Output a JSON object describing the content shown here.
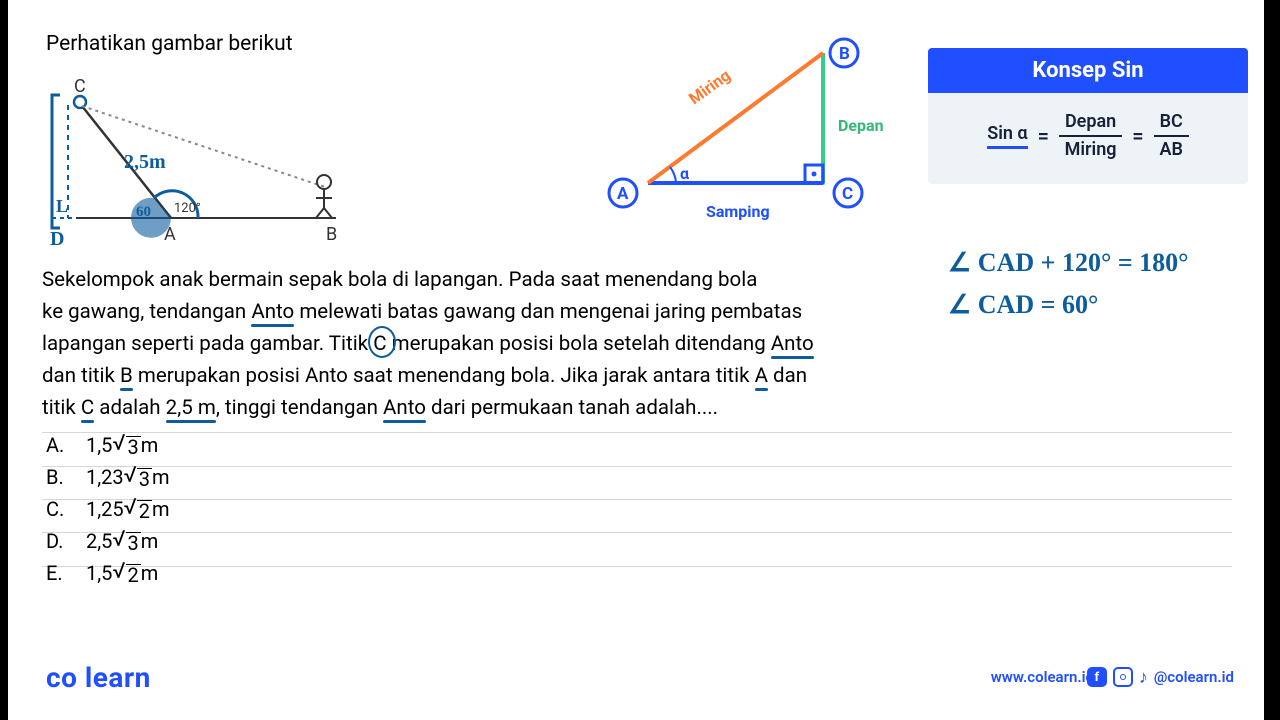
{
  "title": "Perhatikan gambar berikut",
  "concept": {
    "header": "Konsep Sin",
    "lhs": "Sin α",
    "frac1_num": "Depan",
    "frac1_den": "Miring",
    "frac2_num": "BC",
    "frac2_den": "AB"
  },
  "diagram": {
    "problem": {
      "len": "2,5m",
      "angle": "120°",
      "pA": "A",
      "pB": "B",
      "pC": "C",
      "pD": "D",
      "pL": "L",
      "ang60": "60"
    },
    "concept_tri": {
      "pA": "A",
      "pB": "B",
      "pC": "C",
      "alpha": "α",
      "side_hyp": "Miring",
      "side_opp": "Depan",
      "side_adj": "Samping"
    }
  },
  "handwriting": {
    "line1": "∠ CAD + 120° = 180°",
    "line2": "∠ CAD = 60°"
  },
  "question": {
    "p1": "Sekelompok anak bermain sepak bola di lapangan. Pada saat menendang bola",
    "p2a": "ke gawang, tendangan ",
    "p2b": "Anto",
    "p2c": " melewati batas gawang dan mengenai jaring pembatas",
    "p3a": "lapangan seperti pada gambar. Titik ",
    "p3b": "C",
    "p3c": " merupakan posisi bola setelah ditendang ",
    "p3d": "Anto",
    "p4a": "dan titik ",
    "p4b": "B",
    "p4c": " merupakan posisi Anto saat menendang bola. Jika jarak antara titik ",
    "p4d": "A",
    "p4e": " dan",
    "p5a": "titik ",
    "p5b": "C",
    "p5c": " adalah ",
    "p5d": "2,5 m",
    "p5e": ", tinggi tendangan ",
    "p5f": "Anto",
    "p5g": " dari permukaan tanah adalah...."
  },
  "answers": {
    "a": {
      "letter": "A.",
      "coef": "1,5",
      "root": "3",
      "unit": " m"
    },
    "b": {
      "letter": "B.",
      "coef": "1,23",
      "root": "3",
      "unit": " m"
    },
    "c": {
      "letter": "C.",
      "coef": "1,25",
      "root": "2",
      "unit": " m"
    },
    "d": {
      "letter": "D.",
      "coef": "2,5",
      "root": "3",
      "unit": " m"
    },
    "e": {
      "letter": "E.",
      "coef": "1,5",
      "root": "2",
      "unit": " m"
    }
  },
  "footer": {
    "brand": "co learn",
    "url": "www.colearn.id",
    "handle": "@colearn.id"
  }
}
